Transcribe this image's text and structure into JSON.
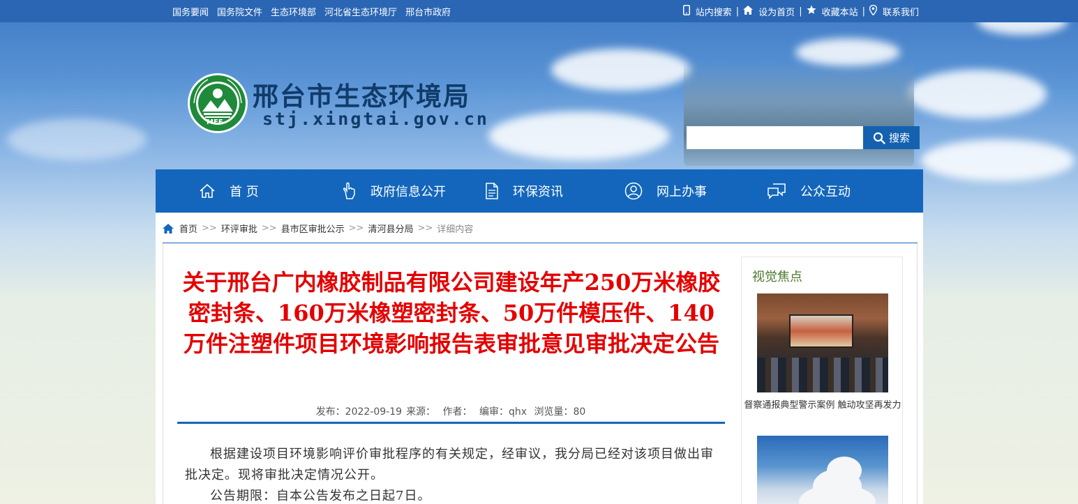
{
  "topbar": {
    "links": [
      "国务要闻",
      "国务院文件",
      "生态环境部",
      "河北省生态环境厅",
      "邢台市政府"
    ],
    "right": [
      {
        "icon": "phone-icon",
        "label": "站内搜索"
      },
      {
        "icon": "home-icon",
        "label": "设为首页"
      },
      {
        "icon": "star-icon",
        "label": "收藏本站"
      },
      {
        "icon": "location-icon",
        "label": "联系我们"
      }
    ]
  },
  "header": {
    "logo_text": "MEE",
    "title": "邢台市生态环境局",
    "domain": "stj.xingtai.gov.cn"
  },
  "search": {
    "value": "",
    "button_label": "搜索"
  },
  "nav": {
    "items": [
      {
        "icon": "home-icon",
        "label": "首 页"
      },
      {
        "icon": "hand-icon",
        "label": "政府信息公开"
      },
      {
        "icon": "document-icon",
        "label": "环保资讯"
      },
      {
        "icon": "user-icon",
        "label": "网上办事"
      },
      {
        "icon": "chat-icon",
        "label": "公众互动"
      }
    ]
  },
  "breadcrumb": {
    "items": [
      "首页",
      "环评审批",
      "县市区审批公示",
      "清河县分局"
    ],
    "current": "详细内容",
    "separator": ">>"
  },
  "article": {
    "title": "关于邢台广内橡胶制品有限公司建设年产250万米橡胶密封条、160万米橡塑密封条、50万件模压件、140万件注塑件项目环境影响报告表审批意见审批决定公告",
    "meta": {
      "publish": "发布：2022-09-19",
      "source": "来源：",
      "author": "作者：",
      "editor": "编审：qhx",
      "views": "浏览量：80"
    },
    "paragraphs": [
      "根据建设项目环境影响评价审批程序的有关规定，经审议，我分局已经对该项目做出审批决定。现将审批决定情况公开。",
      "公告期限：自本公告发布之日起7日。"
    ]
  },
  "sidebar": {
    "title": "视觉焦点",
    "items": [
      {
        "caption": "督察通报典型警示案例 触动攻坚再发力"
      }
    ]
  },
  "colors": {
    "nav_blue": "#1366bb",
    "title_red": "#e30000",
    "sidebar_title_green": "#4a7a2a"
  }
}
